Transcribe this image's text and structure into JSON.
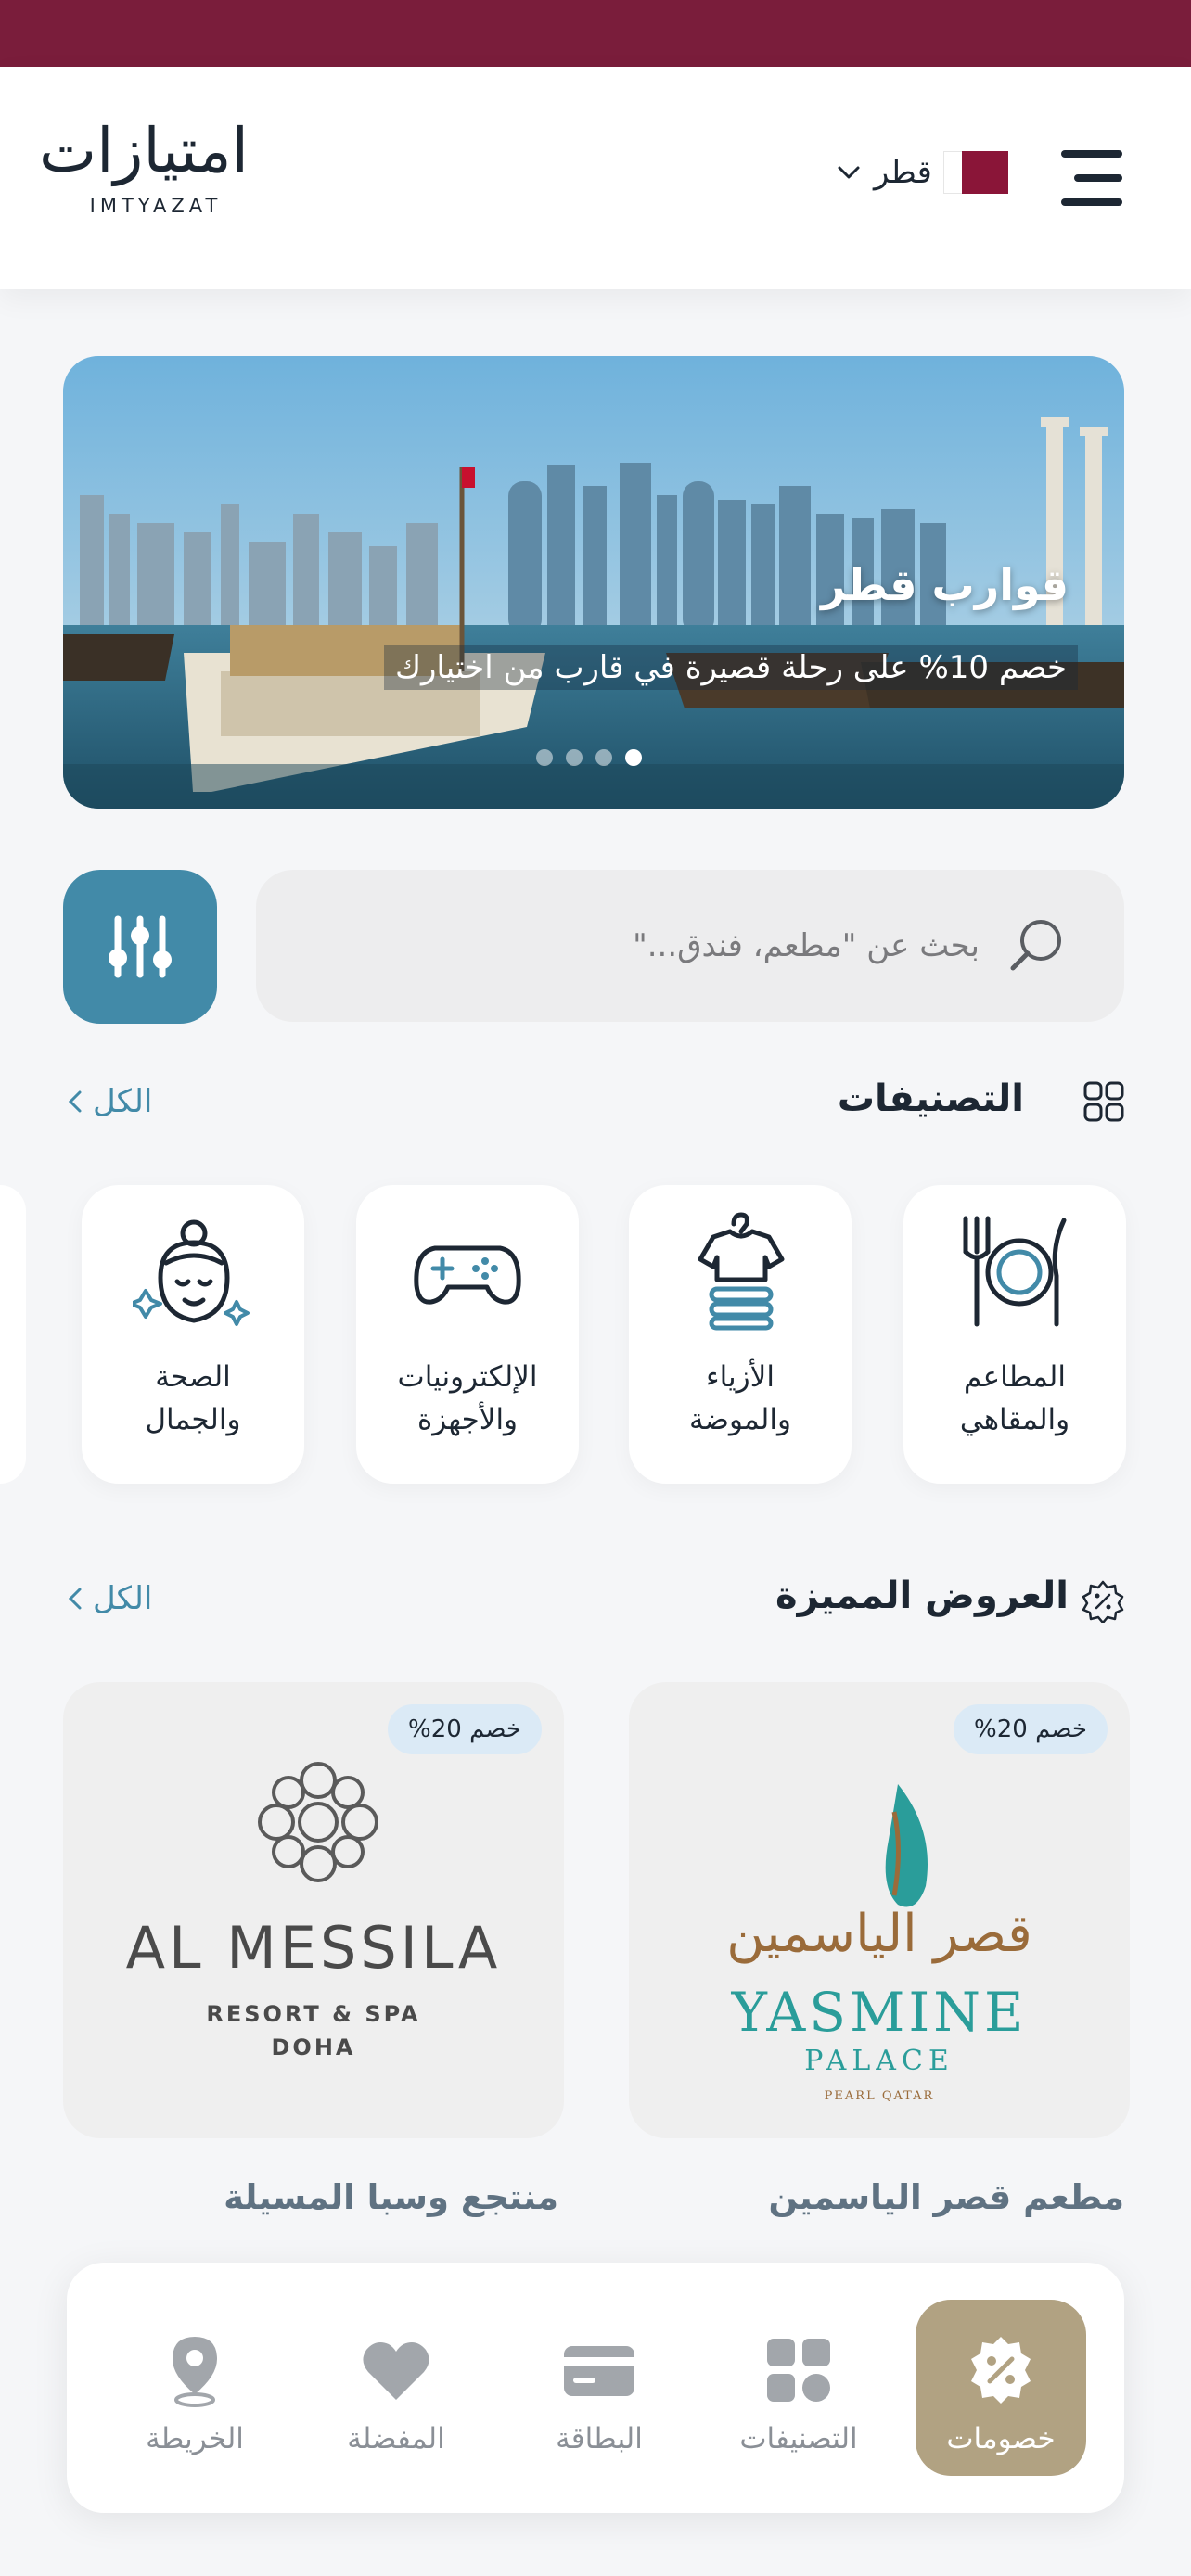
{
  "header": {
    "logo_arabic": "امتيازات",
    "logo_english": "IMTYAZAT",
    "country_name": "قطر"
  },
  "banner": {
    "title": "قوارب قطر",
    "subtitle": "خصم 10% على رحلة قصيرة في قارب من اختيارك",
    "slide_count": 4,
    "active_slide": 4
  },
  "search": {
    "placeholder": "بحث عن \"مطعم، فندق...\""
  },
  "categories": {
    "title": "التصنيفات",
    "see_all": "الكل",
    "items": [
      {
        "label_line1": "المطاعم",
        "label_line2": "والمقاهي",
        "icon": "plate-cutlery-icon"
      },
      {
        "label_line1": "الأزياء",
        "label_line2": "والموضة",
        "icon": "shirt-hanger-icon"
      },
      {
        "label_line1": "الإلكترونيات",
        "label_line2": "والأجهزة",
        "icon": "gamepad-icon"
      },
      {
        "label_line1": "الصحة",
        "label_line2": "والجمال",
        "icon": "spa-face-icon"
      }
    ]
  },
  "featured": {
    "title": "العروض المميزة",
    "see_all": "الكل",
    "offers": [
      {
        "name": "مطعم قصر الياسمين",
        "badge": "خصم 20%",
        "logo_text": "YASMINE",
        "logo_sub": "PALACE",
        "logo_small": "PEARL QATAR",
        "logo_ar": "قصر الياسمين"
      },
      {
        "name": "منتجع وسبا المسيلة",
        "badge": "خصم 20%",
        "logo_text": "AL MESSILA",
        "logo_sub": "RESORT & SPA",
        "logo_small": "DOHA"
      }
    ]
  },
  "tabbar": {
    "items": [
      {
        "label": "خصومات",
        "icon": "discount-badge-icon",
        "active": true
      },
      {
        "label": "التصنيفات",
        "icon": "grid-icon",
        "active": false
      },
      {
        "label": "البطاقة",
        "icon": "card-icon",
        "active": false
      },
      {
        "label": "المفضلة",
        "icon": "heart-icon",
        "active": false
      },
      {
        "label": "الخريطة",
        "icon": "map-pin-icon",
        "active": false
      }
    ]
  },
  "colors": {
    "maroon": "#7a1d3b",
    "teal": "#428aa8",
    "gold": "#b1a282",
    "text_dark": "#1d2733"
  }
}
